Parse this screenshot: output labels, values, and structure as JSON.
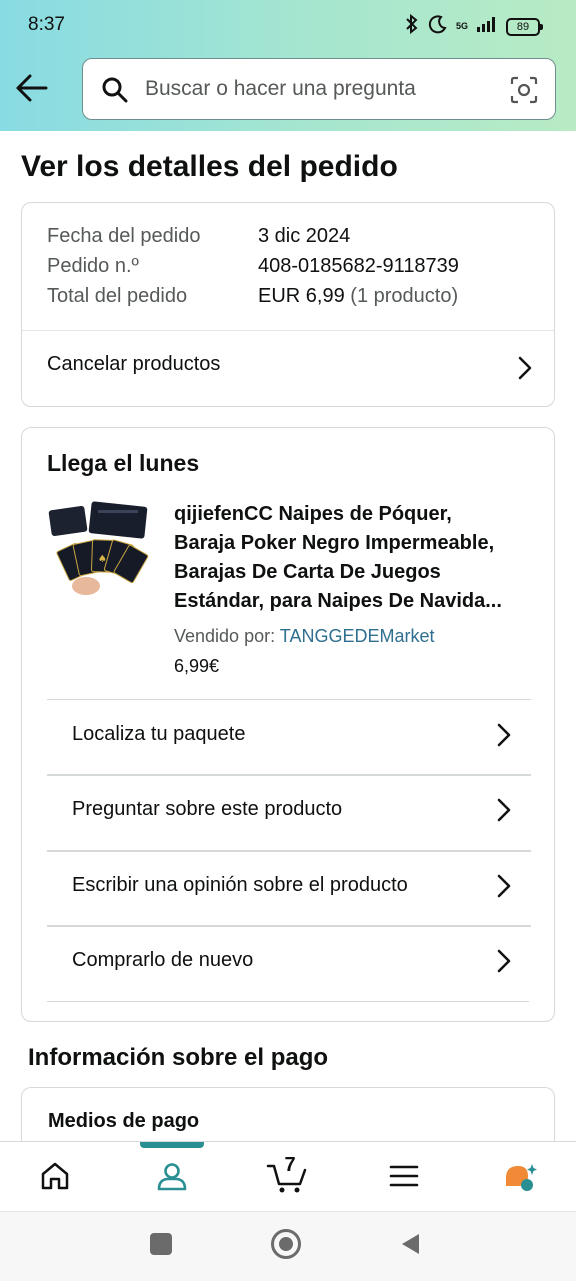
{
  "status": {
    "time": "8:37",
    "network": "5G",
    "battery": "89"
  },
  "search": {
    "placeholder": "Buscar o hacer una pregunta"
  },
  "page": {
    "title": "Ver los detalles del pedido"
  },
  "order": {
    "date_label": "Fecha del pedido",
    "date_value": "3 dic 2024",
    "number_label": "Pedido n.º",
    "number_value": "408-0185682-9118739",
    "total_label": "Total del pedido",
    "total_value": "EUR 6,99",
    "total_sub": "(1 producto)",
    "cancel_label": "Cancelar productos"
  },
  "shipment": {
    "arrival": "Llega el lunes",
    "product_title_lines": [
      "qijiefenCC Naipes de Póquer,",
      "Baraja Poker Negro Impermeable,",
      "Barajas De Carta De Juegos",
      "Estándar, para Naipes De Navida..."
    ],
    "sold_by_label": "Vendido por:",
    "seller": "TANGGEDEMarket",
    "price": "6,99€",
    "actions": [
      {
        "label": "Localiza tu paquete"
      },
      {
        "label": "Preguntar sobre este producto"
      },
      {
        "label": "Escribir una opinión sobre el producto"
      },
      {
        "label": "Comprarlo de nuevo"
      }
    ]
  },
  "payment": {
    "title": "Información sobre el pago",
    "methods_label": "Medios de pago"
  },
  "bottom_nav": {
    "items": [
      "home-icon",
      "account-icon",
      "cart-icon",
      "menu-icon",
      "rufus-icon"
    ],
    "cart_count": "7",
    "active": "account"
  },
  "colors": {
    "accent": "#2a8f93",
    "link": "#2f6f8f",
    "header_start": "#88dbe3",
    "header_end": "#b8ebc4"
  }
}
